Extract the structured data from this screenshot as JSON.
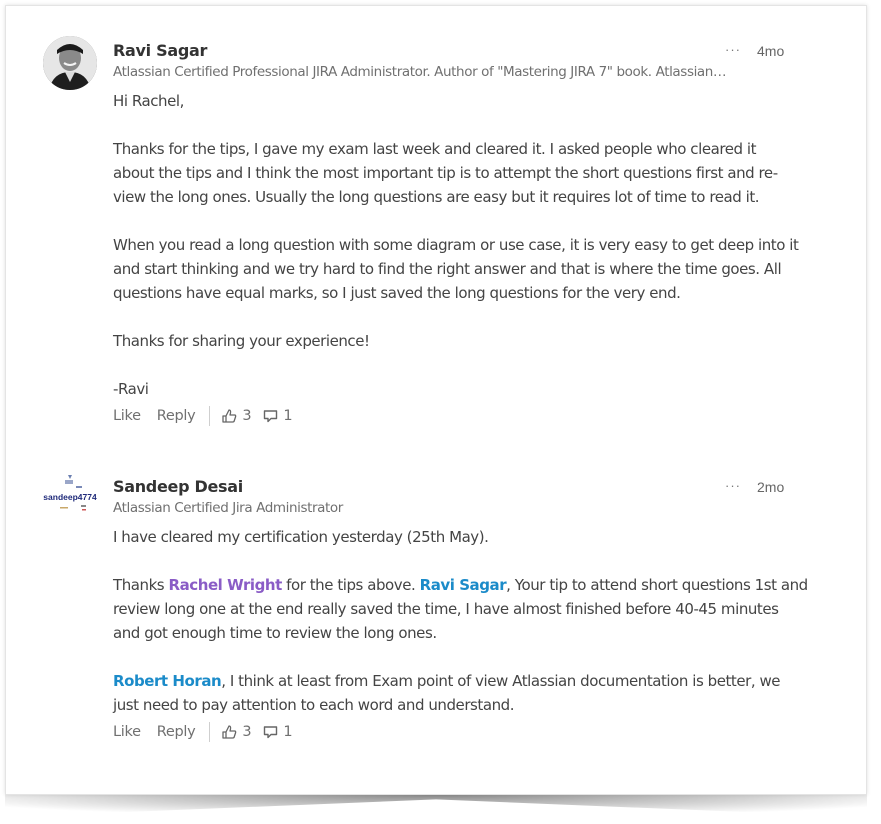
{
  "comments": [
    {
      "author": "Ravi Sagar",
      "subtitle": "Atlassian Certified Professional JIRA Administrator. Author of \"Mastering JIRA 7\" book. Atlassian…",
      "time": "4mo",
      "more": "···",
      "avatar": "profile-photo",
      "body": [
        "Hi Rachel,",
        "",
        "Thanks for the tips, I gave my exam last week and cleared it. I asked people who cleared it",
        "about the tips and I think the most important tip is to attempt the short questions first and re-",
        "view the long ones. Usually the long questions are easy but it requires lot of time to read it.",
        "",
        "When you read a long question with some diagram or use case, it is very easy to get deep into it",
        "and start thinking and we try hard to find the right answer and that is where the time goes. All",
        "questions have equal marks, so I just saved the long questions for the very end.",
        "",
        "Thanks for sharing your experience!",
        "",
        "-Ravi"
      ],
      "actions": {
        "like": "Like",
        "reply": "Reply",
        "likes": "3",
        "replies": "1"
      }
    },
    {
      "author": "Sandeep Desai",
      "subtitle": "Atlassian Certified Jira Administrator",
      "time": "2mo",
      "more": "···",
      "avatar": "sandeep4774",
      "body_line1": "I have cleared my certification yesterday (25th May).",
      "p2": {
        "t1": "Thanks ",
        "m1": "Rachel Wright",
        "t2": " for the tips above. ",
        "m2": "Ravi Sagar",
        "t3": ", Your tip to attend short questions 1st and",
        "l2": "review long one at the end really saved the time, I have almost finished before 40-45 minutes",
        "l3": "and got enough time to review the long ones."
      },
      "p3": {
        "m1": "Robert Horan",
        "t1": ", I think at least from Exam point of view Atlassian documentation is better, we",
        "l2": "just need to pay attention to each word and understand."
      },
      "actions": {
        "like": "Like",
        "reply": "Reply",
        "likes": "3",
        "replies": "1"
      }
    }
  ],
  "colors": {
    "mention_purple": "#8a5cc6",
    "mention_blue": "#1b8bc9"
  }
}
